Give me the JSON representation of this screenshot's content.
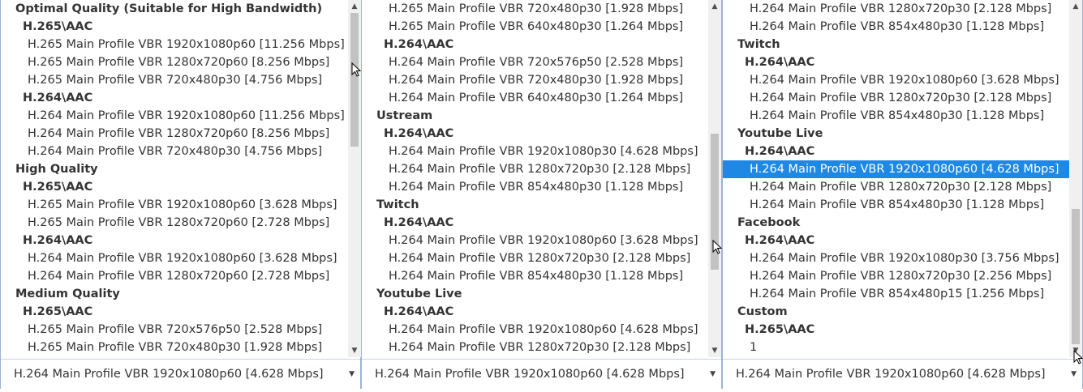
{
  "panels": [
    {
      "rows": [
        {
          "level": 0,
          "text": "Optimal Quality (Suitable for High Bandwidth)"
        },
        {
          "level": 1,
          "text": "H.265\\AAC"
        },
        {
          "level": 2,
          "text": "H.265 Main Profile VBR 1920x1080p60 [11.256 Mbps]"
        },
        {
          "level": 2,
          "text": "H.265 Main Profile VBR 1280x720p60 [8.256 Mbps]"
        },
        {
          "level": 2,
          "text": "H.265 Main Profile VBR 720x480p30 [4.756 Mbps]"
        },
        {
          "level": 1,
          "text": "H.264\\AAC"
        },
        {
          "level": 2,
          "text": "H.264 Main Profile VBR 1920x1080p60 [11.256 Mbps]"
        },
        {
          "level": 2,
          "text": "H.264 Main Profile VBR 1280x720p60 [8.256 Mbps]"
        },
        {
          "level": 2,
          "text": "H.264 Main Profile VBR 720x480p30 [4.756 Mbps]"
        },
        {
          "level": 0,
          "text": "High Quality"
        },
        {
          "level": 1,
          "text": "H.265\\AAC"
        },
        {
          "level": 2,
          "text": "H.265 Main Profile VBR 1920x1080p60 [3.628 Mbps]"
        },
        {
          "level": 2,
          "text": "H.265 Main Profile VBR 1280x720p60 [2.728 Mbps]"
        },
        {
          "level": 1,
          "text": "H.264\\AAC"
        },
        {
          "level": 2,
          "text": "H.264 Main Profile VBR 1920x1080p60 [3.628 Mbps]"
        },
        {
          "level": 2,
          "text": "H.264 Main Profile VBR 1280x720p60 [2.728 Mbps]"
        },
        {
          "level": 0,
          "text": "Medium Quality"
        },
        {
          "level": 1,
          "text": "H.265\\AAC"
        },
        {
          "level": 2,
          "text": "H.265 Main Profile VBR 720x576p50 [2.528 Mbps]"
        },
        {
          "level": 2,
          "text": "H.265 Main Profile VBR 720x480p30 [1.928 Mbps]"
        }
      ],
      "dropdown_value": "H.264 Main Profile VBR 1920x1080p60 [4.628 Mbps]",
      "scroll_position": 0.0,
      "icons": {
        "scroll_up": "scroll-up-arrow-icon",
        "scroll_down": "scroll-down-arrow-icon",
        "dropdown": "chevron-down-icon"
      }
    },
    {
      "rows": [
        {
          "level": 2,
          "text": "H.265 Main Profile VBR 720x480p30 [1.928 Mbps]"
        },
        {
          "level": 2,
          "text": "H.265 Main Profile VBR 640x480p30 [1.264 Mbps]"
        },
        {
          "level": 1,
          "text": "H.264\\AAC"
        },
        {
          "level": 2,
          "text": "H.264 Main Profile VBR 720x576p50 [2.528 Mbps]"
        },
        {
          "level": 2,
          "text": "H.264 Main Profile VBR 720x480p30 [1.928 Mbps]"
        },
        {
          "level": 2,
          "text": "H.264 Main Profile VBR 640x480p30 [1.264 Mbps]"
        },
        {
          "level": 0,
          "text": "Ustream"
        },
        {
          "level": 1,
          "text": "H.264\\AAC"
        },
        {
          "level": 2,
          "text": "H.264 Main Profile VBR 1920x1080p30 [4.628 Mbps]"
        },
        {
          "level": 2,
          "text": "H.264 Main Profile VBR 1280x720p30 [2.128 Mbps]"
        },
        {
          "level": 2,
          "text": "H.264 Main Profile VBR 854x480p30 [1.128 Mbps]"
        },
        {
          "level": 0,
          "text": "Twitch"
        },
        {
          "level": 1,
          "text": "H.264\\AAC"
        },
        {
          "level": 2,
          "text": "H.264 Main Profile VBR 1920x1080p60 [3.628 Mbps]"
        },
        {
          "level": 2,
          "text": "H.264 Main Profile VBR 1280x720p30 [2.128 Mbps]"
        },
        {
          "level": 2,
          "text": "H.264 Main Profile VBR 854x480p30 [1.128 Mbps]"
        },
        {
          "level": 0,
          "text": "Youtube Live"
        },
        {
          "level": 1,
          "text": "H.264\\AAC"
        },
        {
          "level": 2,
          "text": "H.264 Main Profile VBR 1920x1080p60 [4.628 Mbps]"
        },
        {
          "level": 2,
          "text": "H.264 Main Profile VBR 1280x720p30 [2.128 Mbps]"
        }
      ],
      "dropdown_value": "H.264 Main Profile VBR 1920x1080p60 [4.628 Mbps]",
      "scroll_position": 0.62,
      "icons": {
        "scroll_up": "scroll-up-arrow-icon",
        "scroll_down": "scroll-down-arrow-icon",
        "dropdown": "chevron-down-icon"
      }
    },
    {
      "rows": [
        {
          "level": 2,
          "text": "H.264 Main Profile VBR 1280x720p30 [2.128 Mbps]"
        },
        {
          "level": 2,
          "text": "H.264 Main Profile VBR 854x480p30 [1.128 Mbps]"
        },
        {
          "level": 0,
          "text": "Twitch"
        },
        {
          "level": 1,
          "text": "H.264\\AAC"
        },
        {
          "level": 2,
          "text": "H.264 Main Profile VBR 1920x1080p60 [3.628 Mbps]"
        },
        {
          "level": 2,
          "text": "H.264 Main Profile VBR 1280x720p30 [2.128 Mbps]"
        },
        {
          "level": 2,
          "text": "H.264 Main Profile VBR 854x480p30 [1.128 Mbps]"
        },
        {
          "level": 0,
          "text": "Youtube Live"
        },
        {
          "level": 1,
          "text": "H.264\\AAC"
        },
        {
          "level": 2,
          "text": "H.264 Main Profile VBR 1920x1080p60 [4.628 Mbps]",
          "selected": true
        },
        {
          "level": 2,
          "text": "H.264 Main Profile VBR 1280x720p30 [2.128 Mbps]"
        },
        {
          "level": 2,
          "text": "H.264 Main Profile VBR 854x480p30 [1.128 Mbps]"
        },
        {
          "level": 0,
          "text": "Facebook"
        },
        {
          "level": 1,
          "text": "H.264\\AAC"
        },
        {
          "level": 2,
          "text": "H.264 Main Profile VBR 1920x1080p30 [3.756 Mbps]"
        },
        {
          "level": 2,
          "text": "H.264 Main Profile VBR 1280x720p30 [2.256 Mbps]"
        },
        {
          "level": 2,
          "text": "H.264 Main Profile VBR 854x480p15 [1.256 Mbps]"
        },
        {
          "level": 0,
          "text": "Custom"
        },
        {
          "level": 1,
          "text": "H.265\\AAC"
        },
        {
          "level": 2,
          "text": "1"
        }
      ],
      "dropdown_value": "H.264 Main Profile VBR 1920x1080p60 [4.628 Mbps]",
      "scroll_position": 1.0,
      "icons": {
        "scroll_up": "scroll-up-arrow-icon",
        "scroll_down": "scroll-down-arrow-icon",
        "dropdown": "chevron-down-icon"
      }
    }
  ],
  "colors": {
    "selection": "#1e88e5",
    "border": "#9db3d6",
    "scrollbar_track": "#f0f0f0",
    "scrollbar_thumb": "#c2c2c2",
    "text": "#333333"
  }
}
